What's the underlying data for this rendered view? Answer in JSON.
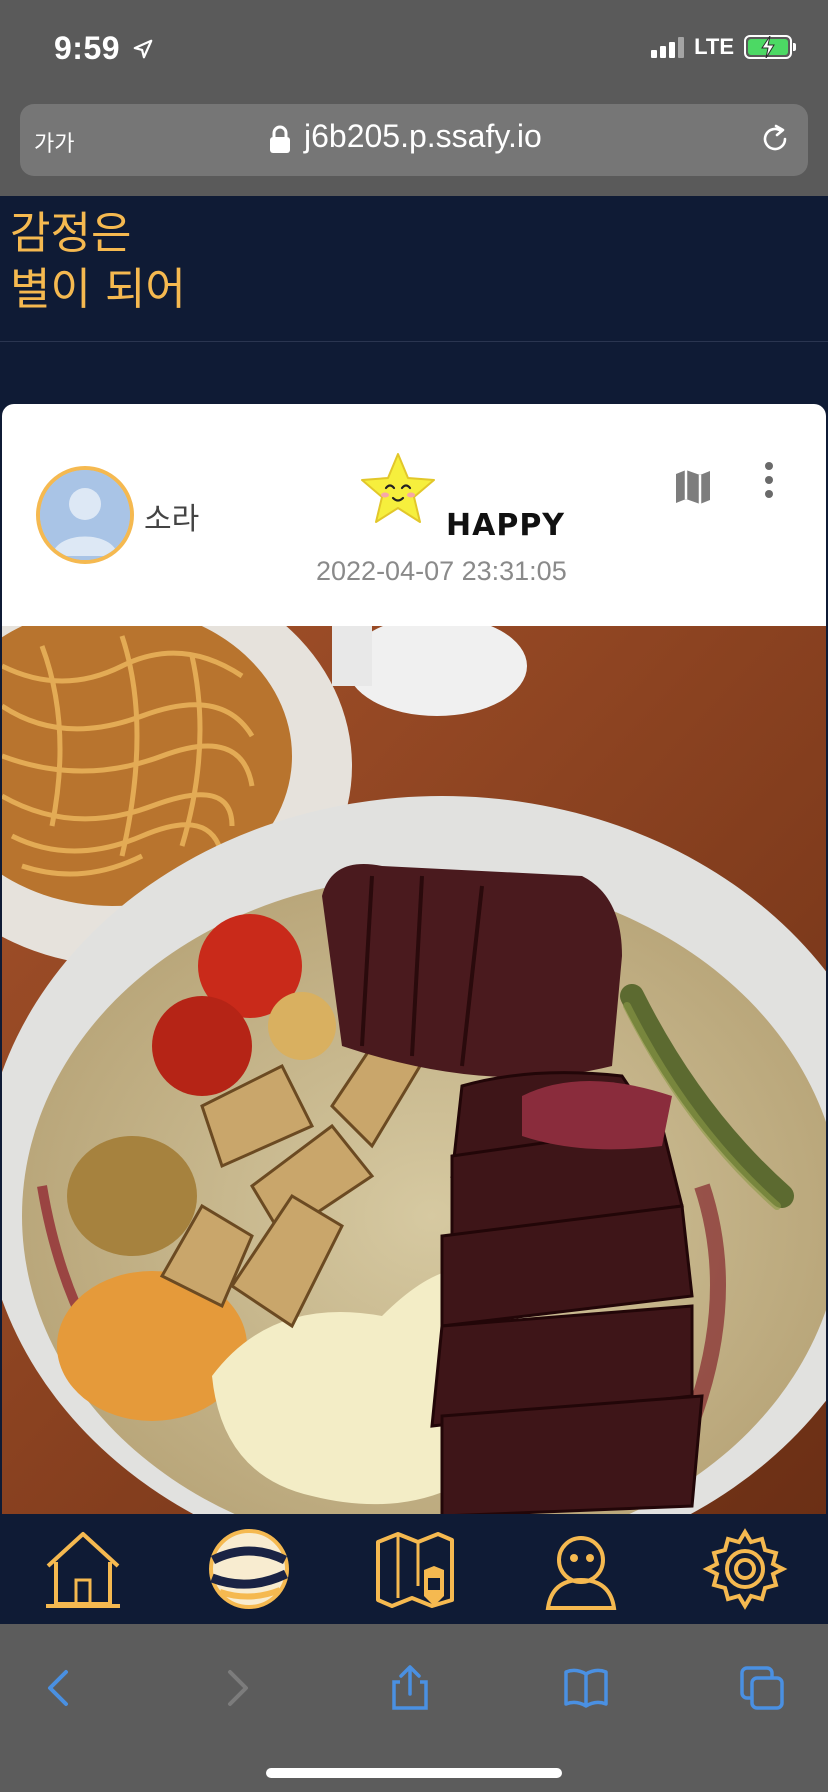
{
  "status_bar": {
    "time": "9:59",
    "network": "LTE"
  },
  "browser": {
    "text_size_label": "가가",
    "url": "j6b205.p.ssafy.io"
  },
  "app": {
    "title_line1": "감정은",
    "title_line2": "별이 되어",
    "accent_color": "#f5b950",
    "background_color": "#0f1b35"
  },
  "post": {
    "username": "소라",
    "emotion_label": "HAPPY",
    "date": "2022-04-07 23:31:05",
    "emotion_icon": "happy-star-icon",
    "photo_subject": "steak plate with pasta"
  },
  "bottom_nav": {
    "items": [
      {
        "icon": "home-icon"
      },
      {
        "icon": "planet-icon"
      },
      {
        "icon": "map-edit-icon"
      },
      {
        "icon": "profile-icon"
      },
      {
        "icon": "settings-icon"
      }
    ]
  },
  "safari_toolbar": {
    "items": [
      "back-icon",
      "forward-icon",
      "share-icon",
      "bookmarks-icon",
      "tabs-icon"
    ]
  }
}
